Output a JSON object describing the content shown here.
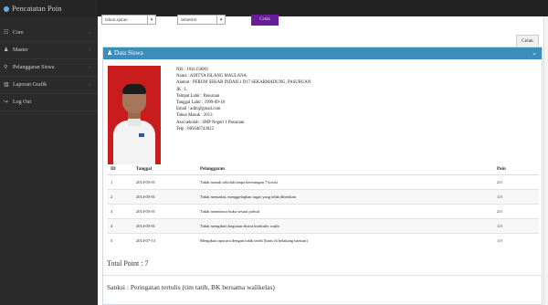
{
  "app": {
    "title": "Pencatatan Poin"
  },
  "sidebar": {
    "items": [
      {
        "icon": "☷",
        "icon_name": "grid-icon",
        "label": "Core",
        "chevron": "›"
      },
      {
        "icon": "♟",
        "icon_name": "user-icon",
        "label": "Master",
        "chevron": "›"
      },
      {
        "icon": "⚲",
        "icon_name": "search-icon",
        "label": "Pelanggaran Siswa",
        "chevron": "›"
      },
      {
        "icon": "▥",
        "icon_name": "chart-icon",
        "label": "Laporan Grafik",
        "chevron": "›"
      },
      {
        "icon": "↪",
        "icon_name": "logout-icon",
        "label": "Log Out",
        "chevron": ""
      }
    ]
  },
  "filters": {
    "select1": "tahun ajaran",
    "select2": "semester",
    "button": "Cetak"
  },
  "toolbar": {
    "print_label": "Cetak"
  },
  "panel": {
    "title": "Data Siswa",
    "chevron": "⌄"
  },
  "student": {
    "nis": "NIS : 1041150001",
    "nama": "Nama : ADITYA ISLANG MAULANA",
    "alamat": "Alamat : PERUM SEKAR INDAH 1 D17 SEKARMADUNG, PASURUAN",
    "jk": "JK : L",
    "tempat_lahir": "Tempat Lahir : Pasuruan",
    "tanggal_lahir": "Tanggal Lahir : 1999-09-18",
    "email": "Email : aditi@gmail.com",
    "tahun_masuk": "Tahun Masuk : 2013",
    "asal_sekolah": "Asal sekolah : SMP Negeri 1 Pasuruan",
    "telp": "Telp : 085646743022"
  },
  "table": {
    "headers": [
      "ID",
      "Tanggal",
      "Pelanggaran",
      "Poin"
    ],
    "rows": [
      {
        "id": "1",
        "tanggal": "2014-05-01",
        "pelanggaran": "Tidak masuk sekolah tanpa keterangan 7 kosisi",
        "poin": "2.0"
      },
      {
        "id": "2",
        "tanggal": "2014-05-01",
        "pelanggaran": "Tidak memakai, menggelapkan tugas yang telah diberikan",
        "poin": "1.0"
      },
      {
        "id": "3",
        "tanggal": "2014-05-01",
        "pelanggaran": "Tidak membawa buku sesuai jadwal",
        "poin": "2.0"
      },
      {
        "id": "4",
        "tanggal": "2014-05-01",
        "pelanggaran": "Tidak mengikuti kegiatan ekstra kurikuler wajib",
        "poin": "1.0"
      },
      {
        "id": "5",
        "tanggal": "2014-07-13",
        "pelanggaran": "Mengikuti upacara dengan tidak tertib (baris di belakang barisan)",
        "poin": "1.0"
      }
    ]
  },
  "summary": {
    "total": "Total Point : 7",
    "sanksi": "Sanksi : Peringatan tertulis (tim tatib, BK bersama walikelas)"
  }
}
